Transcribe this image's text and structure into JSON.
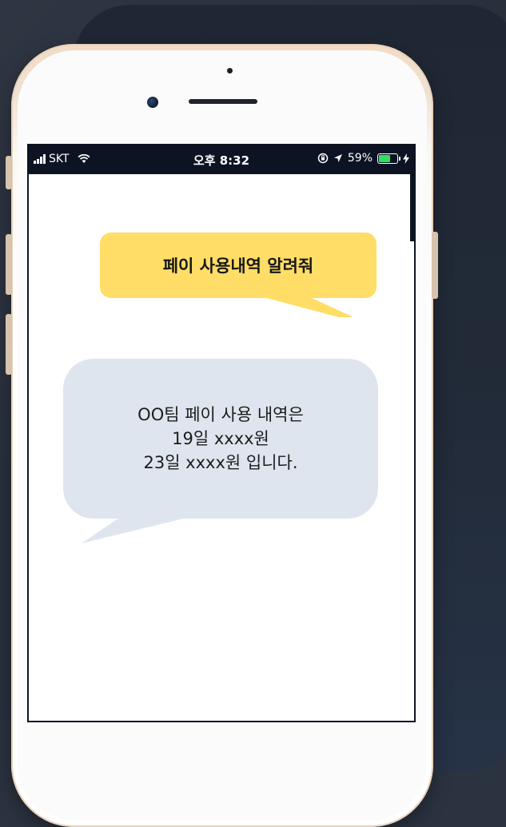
{
  "status_bar": {
    "carrier": "SKT",
    "time": "오후 8:32",
    "battery_percent": "59%",
    "battery_level": 0.59,
    "battery_color": "#2ee05a",
    "icons": [
      "signal-bars-icon",
      "wifi-icon",
      "orientation-lock-icon",
      "location-arrow-icon",
      "battery-icon",
      "charging-bolt-icon"
    ]
  },
  "chat": {
    "user_message": "페이 사용내역 알려줘",
    "reply_lines": [
      "OO팀 페이 사용 내역은",
      "19일 xxxx원",
      "23일 xxxx원 입니다."
    ]
  },
  "colors": {
    "user_bubble": "#ffdd66",
    "reply_bubble": "#dfe5ef",
    "status_bar_bg": "#0c1424"
  }
}
